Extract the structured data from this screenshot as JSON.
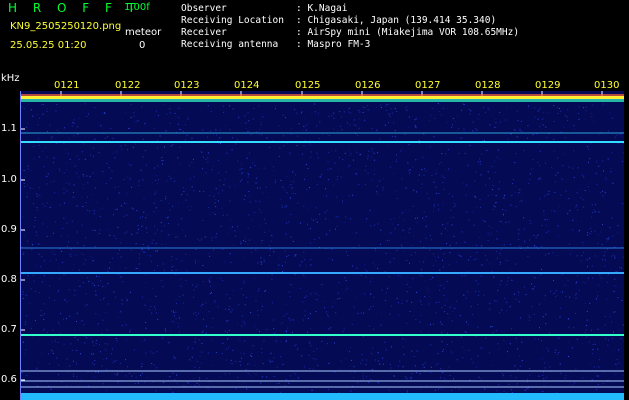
{
  "header": {
    "app_title": "H R O F F T",
    "version": "1.00f",
    "filename": "KN9_2505250120.png",
    "datetime": "25.05.25 01:20",
    "meteor_label": "meteor",
    "meteor_count": "0"
  },
  "info": [
    {
      "label": "Observer",
      "value": ": K.Nagai"
    },
    {
      "label": "Receiving Location",
      "value": ": Chigasaki, Japan (139.414 35.340)"
    },
    {
      "label": "Receiver",
      "value": ": AirSpy mini (Miakejima VOR 108.65MHz)"
    },
    {
      "label": "Receiving antenna",
      "value": ": Maspro FM-3"
    }
  ],
  "axis": {
    "y_unit": "kHz",
    "y_ticks": [
      "1.1",
      "1.0",
      "0.9",
      "0.8",
      "0.7",
      "0.6"
    ],
    "x_ticks": [
      "0121",
      "0122",
      "0123",
      "0124",
      "0125",
      "0126",
      "0127",
      "0128",
      "0129",
      "0130"
    ]
  },
  "colors": {
    "background": "#000000",
    "plot": "#050a55",
    "title_green": "#00ff33",
    "yellow_text": "#ffff33",
    "signal_cyan": "#33ccff"
  }
}
